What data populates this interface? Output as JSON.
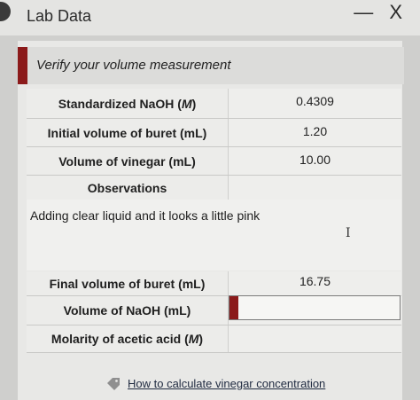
{
  "window": {
    "title": "Lab Data",
    "controls": "— X"
  },
  "prompt": "Verify your volume measurement",
  "rows": [
    {
      "label": "Standardized NaOH (M)",
      "value": "0.4309"
    },
    {
      "label": "Initial volume of buret (mL)",
      "value": "1.20"
    },
    {
      "label": "Volume of vinegar (mL)",
      "value": "10.00"
    }
  ],
  "observations": {
    "label": "Observations",
    "text": "Adding clear liquid and it looks a little pink"
  },
  "final_rows": [
    {
      "label": "Final volume of buret (mL)",
      "value": "16.75"
    },
    {
      "label": "Volume of NaOH (mL)",
      "value": ""
    },
    {
      "label": "Molarity of acetic acid (M)",
      "value": ""
    }
  ],
  "help": {
    "link_text": "How to calculate vinegar concentration",
    "icon": "tag-icon"
  },
  "colors": {
    "accent": "#8b1a1a"
  }
}
